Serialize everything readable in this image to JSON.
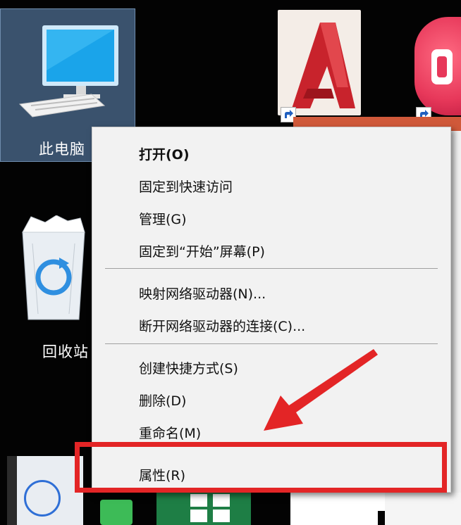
{
  "desktop": {
    "this_pc_label": "此电脑",
    "recycle_bin_label": "回收站"
  },
  "context_menu": {
    "items": [
      {
        "label": "打开(O)"
      },
      {
        "label": "固定到快速访问"
      },
      {
        "label": "管理(G)"
      },
      {
        "label": "固定到“开始”屏幕(P)"
      },
      {
        "label": "映射网络驱动器(N)..."
      },
      {
        "label": "断开网络驱动器的连接(C)..."
      },
      {
        "label": "创建快捷方式(S)"
      },
      {
        "label": "删除(D)"
      },
      {
        "label": "重命名(M)"
      },
      {
        "label": "属性(R)"
      }
    ]
  },
  "colors": {
    "highlight": "#e32526",
    "selection": "#3a526d"
  }
}
